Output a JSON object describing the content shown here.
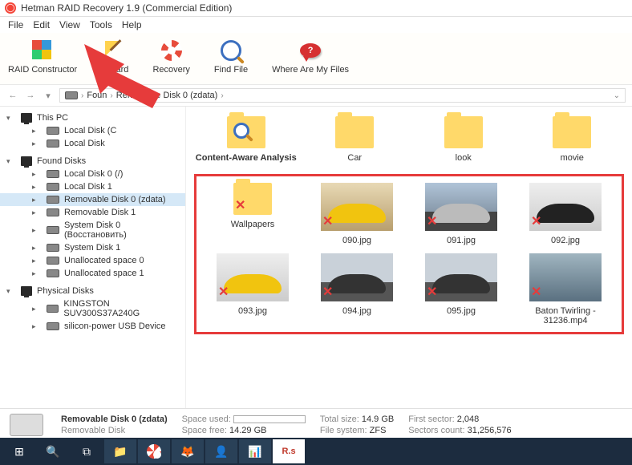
{
  "title": "Hetman RAID Recovery 1.9 (Commercial Edition)",
  "menu": [
    "File",
    "Edit",
    "View",
    "Tools",
    "Help"
  ],
  "toolbar": {
    "raid": "RAID Constructor",
    "wizard": "Wizard",
    "recovery": "Recovery",
    "find": "Find File",
    "where": "Where Are My Files"
  },
  "breadcrumb": {
    "p1": "Foun",
    "p2": "Removable Disk 0 (zdata)"
  },
  "sidebar": {
    "thispc": "This PC",
    "thispc_items": [
      "Local Disk (C",
      "Local Disk"
    ],
    "found": "Found Disks",
    "found_items": [
      "Local Disk 0 (/)",
      "Local Disk 1",
      "Removable Disk 0 (zdata)",
      "Removable Disk 1",
      "System Disk 0 (Восстановить)",
      "System Disk 1",
      "Unallocated space 0",
      "Unallocated space 1"
    ],
    "physical": "Physical Disks",
    "physical_items": [
      "KINGSTON SUV300S37A240G",
      "silicon-power USB Device"
    ]
  },
  "folders": {
    "analysis": "Content-Aware Analysis",
    "car": "Car",
    "look": "look",
    "movie": "movie",
    "wallpapers": "Wallpapers"
  },
  "files": {
    "f090": "090.jpg",
    "f091": "091.jpg",
    "f092": "092.jpg",
    "f093": "093.jpg",
    "f094": "094.jpg",
    "f095": "095.jpg",
    "video": "Baton Twirling - 31236.mp4"
  },
  "status": {
    "disk_name": "Removable Disk 0 (zdata)",
    "disk_sub": "Removable Disk",
    "space_used_label": "Space used:",
    "space_free_label": "Space free:",
    "space_free": "14.29 GB",
    "total_size_label": "Total size:",
    "total_size": "14.9 GB",
    "file_system_label": "File system:",
    "file_system": "ZFS",
    "first_sector_label": "First sector:",
    "first_sector": "2,048",
    "sectors_count_label": "Sectors count:",
    "sectors_count": "31,256,576"
  },
  "taskbar_rs": "R.s"
}
